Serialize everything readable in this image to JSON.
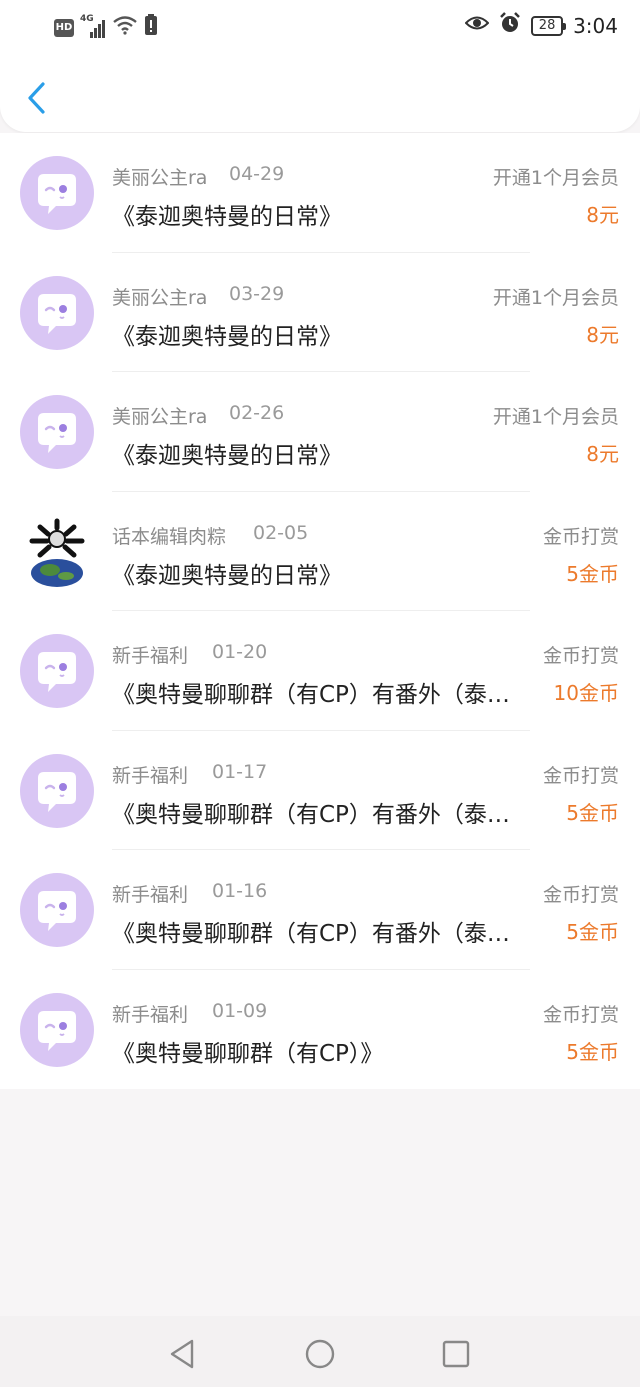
{
  "status_bar": {
    "hd": "HD",
    "network": "4G",
    "battery": "28",
    "time": "3:04",
    "icons": [
      "signal-icon",
      "wifi-icon",
      "alert-icon",
      "eye-icon",
      "alarm-icon",
      "battery-icon"
    ]
  },
  "header": {
    "back_icon": "chevron-left-icon",
    "accent_color": "#2a9ee8"
  },
  "records": [
    {
      "name": "美丽公主ra",
      "date": "04-29",
      "title": "《泰迦奥特曼的日常》",
      "type": "开通1个月会员",
      "amount": "8元",
      "avatar": "default-chat-avatar"
    },
    {
      "name": "美丽公主ra",
      "date": "03-29",
      "title": "《泰迦奥特曼的日常》",
      "type": "开通1个月会员",
      "amount": "8元",
      "avatar": "default-chat-avatar"
    },
    {
      "name": "美丽公主ra",
      "date": "02-26",
      "title": "《泰迦奥特曼的日常》",
      "type": "开通1个月会员",
      "amount": "8元",
      "avatar": "default-chat-avatar"
    },
    {
      "name": "话本编辑肉粽",
      "date": "02-05",
      "title": "《泰迦奥特曼的日常》",
      "type": "金币打赏",
      "amount": "5金币",
      "avatar": "custom-earth-avatar"
    },
    {
      "name": "新手福利",
      "date": "01-20",
      "title": "《奥特曼聊聊群（有CP）有番外（泰…",
      "type": "金币打赏",
      "amount": "10金币",
      "avatar": "default-chat-avatar"
    },
    {
      "name": "新手福利",
      "date": "01-17",
      "title": "《奥特曼聊聊群（有CP）有番外（泰…",
      "type": "金币打赏",
      "amount": "5金币",
      "avatar": "default-chat-avatar"
    },
    {
      "name": "新手福利",
      "date": "01-16",
      "title": "《奥特曼聊聊群（有CP）有番外（泰…",
      "type": "金币打赏",
      "amount": "5金币",
      "avatar": "default-chat-avatar"
    },
    {
      "name": "新手福利",
      "date": "01-09",
      "title": "《奥特曼聊聊群（有CP）》",
      "type": "金币打赏",
      "amount": "5金币",
      "avatar": "default-chat-avatar"
    }
  ],
  "colors": {
    "amount": "#ec7a2c",
    "avatar_bg": "#d9c6f4",
    "meta_text": "#8c8c8c",
    "title_text": "#222222"
  },
  "nav_bar": {
    "icons": [
      "back-triangle-icon",
      "home-circle-icon",
      "recents-square-icon"
    ]
  }
}
